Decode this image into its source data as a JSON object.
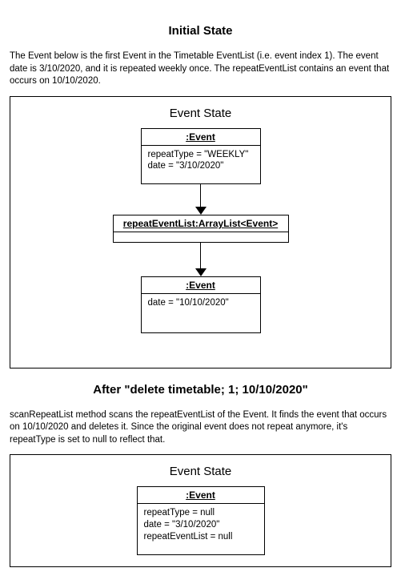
{
  "section1": {
    "title": "Initial State",
    "desc": "The Event below is the first Event in the Timetable EventList (i.e. event index 1). The event date is 3/10/2020, and it is repeated weekly once. The repeatEventList contains an event that occurs on 10/10/2020.",
    "frameTitle": "Event State",
    "event1": {
      "header": ":Event",
      "line1": "repeatType = \"WEEKLY\"",
      "line2": "date = \"3/10/2020\""
    },
    "list": {
      "header": "repeatEventList:ArrayList<Event>"
    },
    "event2": {
      "header": ":Event",
      "line1": "date = \"10/10/2020\""
    }
  },
  "section2": {
    "title": "After \"delete timetable; 1; 10/10/2020\"",
    "desc": "scanRepeatList method scans the repeatEventList of the Event. It finds the event that occurs on 10/10/2020 and deletes it. Since the original event does not repeat anymore, it's repeatType is set to null to reflect that.",
    "frameTitle": "Event State",
    "event": {
      "header": ":Event",
      "line1": "repeatType = null",
      "line2": "date = \"3/10/2020\"",
      "line3": "repeatEventList = null"
    }
  }
}
